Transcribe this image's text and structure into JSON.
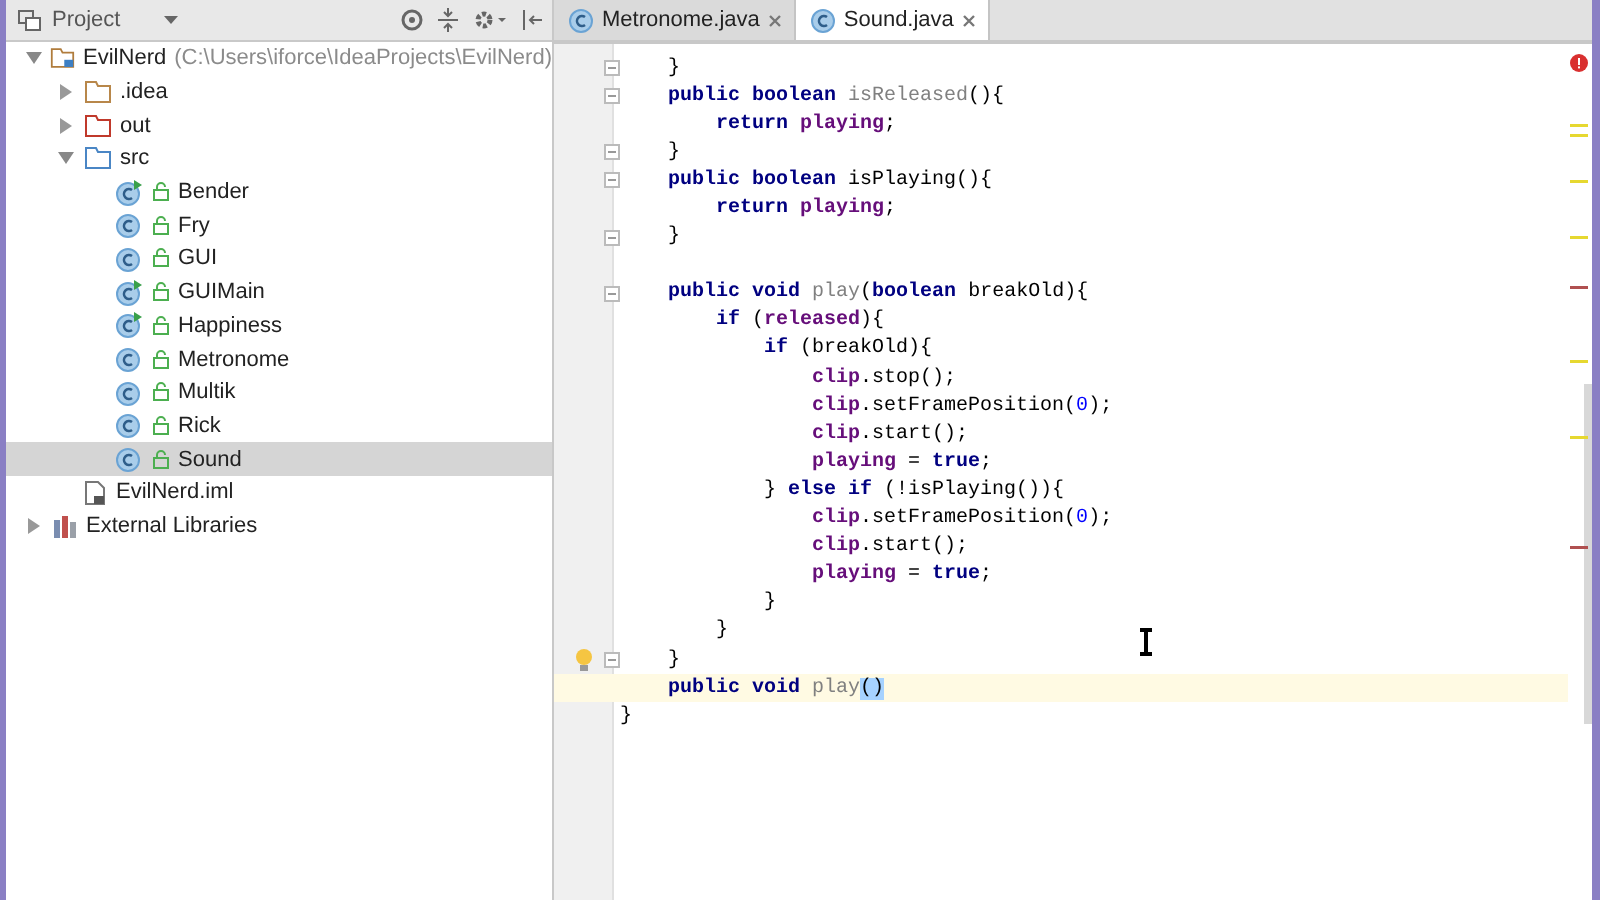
{
  "project_panel": {
    "title": "Project"
  },
  "tree": [
    {
      "kind": "project",
      "label": "EvilNerd",
      "path": "(C:\\Users\\iforce\\IdeaProjects\\EvilNerd)",
      "expanded": true,
      "selected": false,
      "children": [
        {
          "kind": "folder",
          "label": ".idea",
          "expanded": false,
          "selected": false
        },
        {
          "kind": "excluded-folder",
          "label": "out",
          "expanded": false,
          "selected": false
        },
        {
          "kind": "source-folder",
          "label": "src",
          "expanded": true,
          "selected": false,
          "children": [
            {
              "kind": "class",
              "label": "Bender",
              "runnable": true,
              "selected": false
            },
            {
              "kind": "class",
              "label": "Fry",
              "runnable": false,
              "selected": false
            },
            {
              "kind": "class",
              "label": "GUI",
              "runnable": false,
              "selected": false
            },
            {
              "kind": "class",
              "label": "GUIMain",
              "runnable": true,
              "selected": false
            },
            {
              "kind": "class",
              "label": "Happiness",
              "runnable": true,
              "selected": false
            },
            {
              "kind": "class",
              "label": "Metronome",
              "runnable": false,
              "selected": false
            },
            {
              "kind": "class",
              "label": "Multik",
              "runnable": false,
              "selected": false
            },
            {
              "kind": "class",
              "label": "Rick",
              "runnable": false,
              "selected": false
            },
            {
              "kind": "class",
              "label": "Sound",
              "runnable": false,
              "selected": true
            }
          ]
        },
        {
          "kind": "file",
          "label": "EvilNerd.iml",
          "selected": false
        }
      ]
    },
    {
      "kind": "library",
      "label": "External Libraries",
      "expanded": false,
      "selected": false
    }
  ],
  "tabs": [
    {
      "label": "Metronome.java",
      "selected": false
    },
    {
      "label": "Sound.java",
      "selected": true
    }
  ],
  "code": {
    "lines": [
      {
        "kind": "code",
        "fold": true,
        "tokens": [
          {
            "kind": "plain",
            "text": "}"
          }
        ]
      },
      {
        "kind": "code",
        "fold": true,
        "tokens": [
          {
            "kind": "kw",
            "text": "public boolean "
          },
          {
            "kind": "unused",
            "text": "isReleased"
          },
          {
            "kind": "plain",
            "text": "(){"
          }
        ],
        "children": [
          {
            "kind": "code",
            "tokens": [
              {
                "kind": "kw",
                "text": "return "
              },
              {
                "kind": "field",
                "text": "playing"
              },
              {
                "kind": "plain",
                "text": ";"
              }
            ]
          }
        ]
      },
      {
        "kind": "code",
        "fold": true,
        "tokens": [
          {
            "kind": "plain",
            "text": "}"
          }
        ]
      },
      {
        "kind": "code",
        "fold": true,
        "tokens": [
          {
            "kind": "kw",
            "text": "public boolean "
          },
          {
            "kind": "plain",
            "text": "isPlaying(){"
          }
        ],
        "children": [
          {
            "kind": "code",
            "tokens": [
              {
                "kind": "kw",
                "text": "return "
              },
              {
                "kind": "field",
                "text": "playing"
              },
              {
                "kind": "plain",
                "text": ";"
              }
            ]
          }
        ]
      },
      {
        "kind": "code",
        "fold": true,
        "tokens": [
          {
            "kind": "plain",
            "text": "}"
          }
        ]
      },
      {
        "kind": "blank"
      },
      {
        "kind": "code",
        "fold": true,
        "tokens": [
          {
            "kind": "kw",
            "text": "public void "
          },
          {
            "kind": "unused",
            "text": "play"
          },
          {
            "kind": "plain",
            "text": "("
          },
          {
            "kind": "kw",
            "text": "boolean "
          },
          {
            "kind": "plain",
            "text": "breakOld){"
          }
        ],
        "children": [
          {
            "kind": "code",
            "tokens": [
              {
                "kind": "kw",
                "text": "if "
              },
              {
                "kind": "plain",
                "text": "("
              },
              {
                "kind": "field",
                "text": "released"
              },
              {
                "kind": "plain",
                "text": "){"
              }
            ],
            "children": [
              {
                "kind": "code",
                "tokens": [
                  {
                    "kind": "kw",
                    "text": "if "
                  },
                  {
                    "kind": "plain",
                    "text": "(breakOld){"
                  }
                ],
                "children": [
                  {
                    "kind": "code",
                    "tokens": [
                      {
                        "kind": "field",
                        "text": "clip"
                      },
                      {
                        "kind": "plain",
                        "text": ".stop();"
                      }
                    ]
                  },
                  {
                    "kind": "code",
                    "tokens": [
                      {
                        "kind": "field",
                        "text": "clip"
                      },
                      {
                        "kind": "plain",
                        "text": ".setFramePosition("
                      },
                      {
                        "kind": "number",
                        "text": "0"
                      },
                      {
                        "kind": "plain",
                        "text": ");"
                      }
                    ]
                  },
                  {
                    "kind": "code",
                    "tokens": [
                      {
                        "kind": "field",
                        "text": "clip"
                      },
                      {
                        "kind": "plain",
                        "text": ".start();"
                      }
                    ]
                  },
                  {
                    "kind": "code",
                    "tokens": [
                      {
                        "kind": "field",
                        "text": "playing"
                      },
                      {
                        "kind": "plain",
                        "text": " = "
                      },
                      {
                        "kind": "kw",
                        "text": "true"
                      },
                      {
                        "kind": "plain",
                        "text": ";"
                      }
                    ]
                  }
                ]
              },
              {
                "kind": "code",
                "tokens": [
                  {
                    "kind": "plain",
                    "text": "} "
                  },
                  {
                    "kind": "kw",
                    "text": "else if "
                  },
                  {
                    "kind": "plain",
                    "text": "(!isPlaying()){"
                  }
                ],
                "children": [
                  {
                    "kind": "code",
                    "tokens": [
                      {
                        "kind": "field",
                        "text": "clip"
                      },
                      {
                        "kind": "plain",
                        "text": ".setFramePosition("
                      },
                      {
                        "kind": "number",
                        "text": "0"
                      },
                      {
                        "kind": "plain",
                        "text": ");"
                      }
                    ]
                  },
                  {
                    "kind": "code",
                    "tokens": [
                      {
                        "kind": "field",
                        "text": "clip"
                      },
                      {
                        "kind": "plain",
                        "text": ".start();"
                      }
                    ]
                  },
                  {
                    "kind": "code",
                    "tokens": [
                      {
                        "kind": "field",
                        "text": "playing"
                      },
                      {
                        "kind": "plain",
                        "text": " = "
                      },
                      {
                        "kind": "kw",
                        "text": "true"
                      },
                      {
                        "kind": "plain",
                        "text": ";"
                      }
                    ]
                  }
                ]
              },
              {
                "kind": "code",
                "tokens": [
                  {
                    "kind": "plain",
                    "text": "}"
                  }
                ]
              }
            ]
          },
          {
            "kind": "code",
            "tokens": [
              {
                "kind": "plain",
                "text": "}"
              }
            ]
          }
        ]
      },
      {
        "kind": "code",
        "fold": true,
        "bulb": true,
        "tokens": [
          {
            "kind": "plain",
            "text": "}"
          }
        ]
      },
      {
        "kind": "code",
        "current": true,
        "tokens": [
          {
            "kind": "kw",
            "text": "public void "
          },
          {
            "kind": "unused",
            "text": "play"
          },
          {
            "kind": "selected",
            "text": "()"
          }
        ]
      }
    ],
    "end_line": {
      "kind": "code",
      "tokens": [
        {
          "kind": "plain",
          "text": "}"
        }
      ]
    }
  }
}
